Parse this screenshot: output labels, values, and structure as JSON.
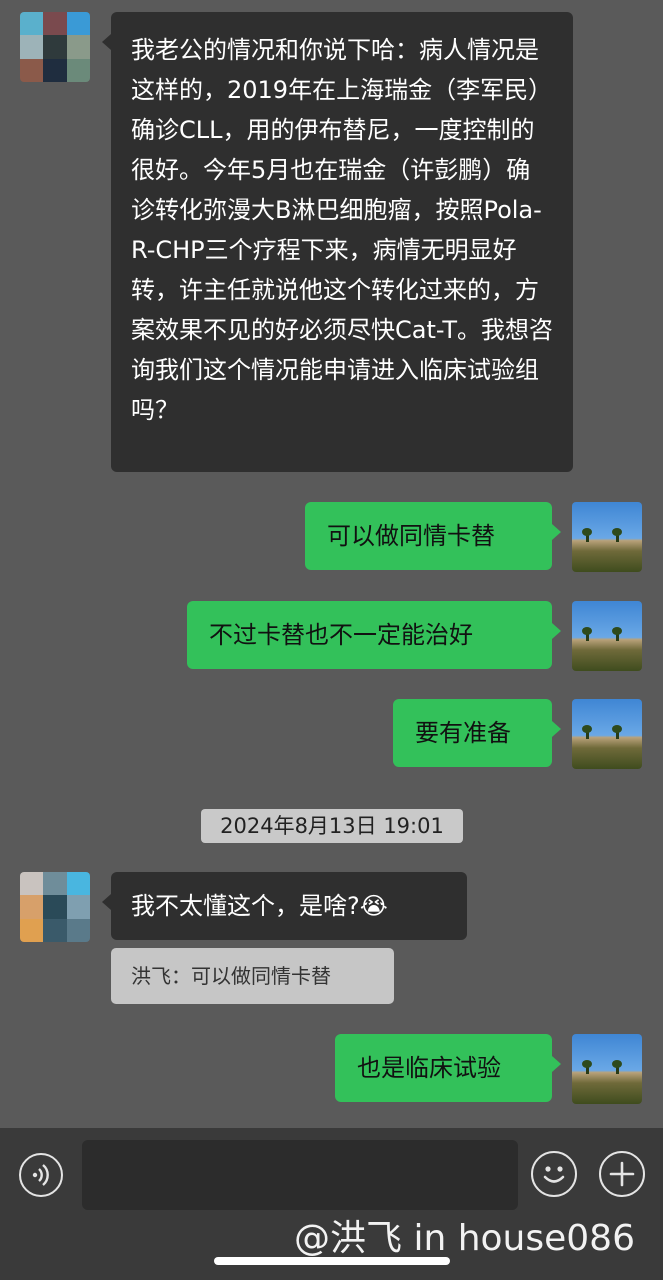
{
  "conversation": {
    "messages": [
      {
        "id": "m1",
        "direction": "received",
        "text": "我老公的情况和你说下哈：病人情况是这样的，2019年在上海瑞金（李军民）确诊CLL，用的伊布替尼，一度控制的很好。今年5月也在瑞金（许彭鹏）确诊转化弥漫大B淋巴细胞瘤，按照Pola-R-CHP三个疗程下来，病情无明显好转，许主任就说他这个转化过来的，方案效果不见的好必须尽快Cat-T。我想咨询我们这个情况能申请进入临床试验组吗？"
      },
      {
        "id": "m2",
        "direction": "sent",
        "text": "可以做同情卡替"
      },
      {
        "id": "m3",
        "direction": "sent",
        "text": "不过卡替也不一定能治好"
      },
      {
        "id": "m4",
        "direction": "sent",
        "text": "要有准备"
      },
      {
        "id": "m5",
        "direction": "received",
        "text": "我不太懂这个，是啥?",
        "emoji": "😭",
        "quote": "洪飞：可以做同情卡替"
      },
      {
        "id": "m6",
        "direction": "sent",
        "text": "也是临床试验"
      }
    ],
    "timestamp": "2024年8月13日 19:01"
  },
  "input_bar": {
    "voice_icon": "voice-icon",
    "emoji_icon": "smiley-icon",
    "plus_icon": "plus-icon",
    "input_value": ""
  },
  "watermark": "@洪飞 in house086",
  "colors": {
    "sent_bubble": "#33c15a",
    "received_bubble": "#2f2f2f",
    "chat_background": "#5a5a5a",
    "timestamp_background": "#c9c9c9"
  }
}
